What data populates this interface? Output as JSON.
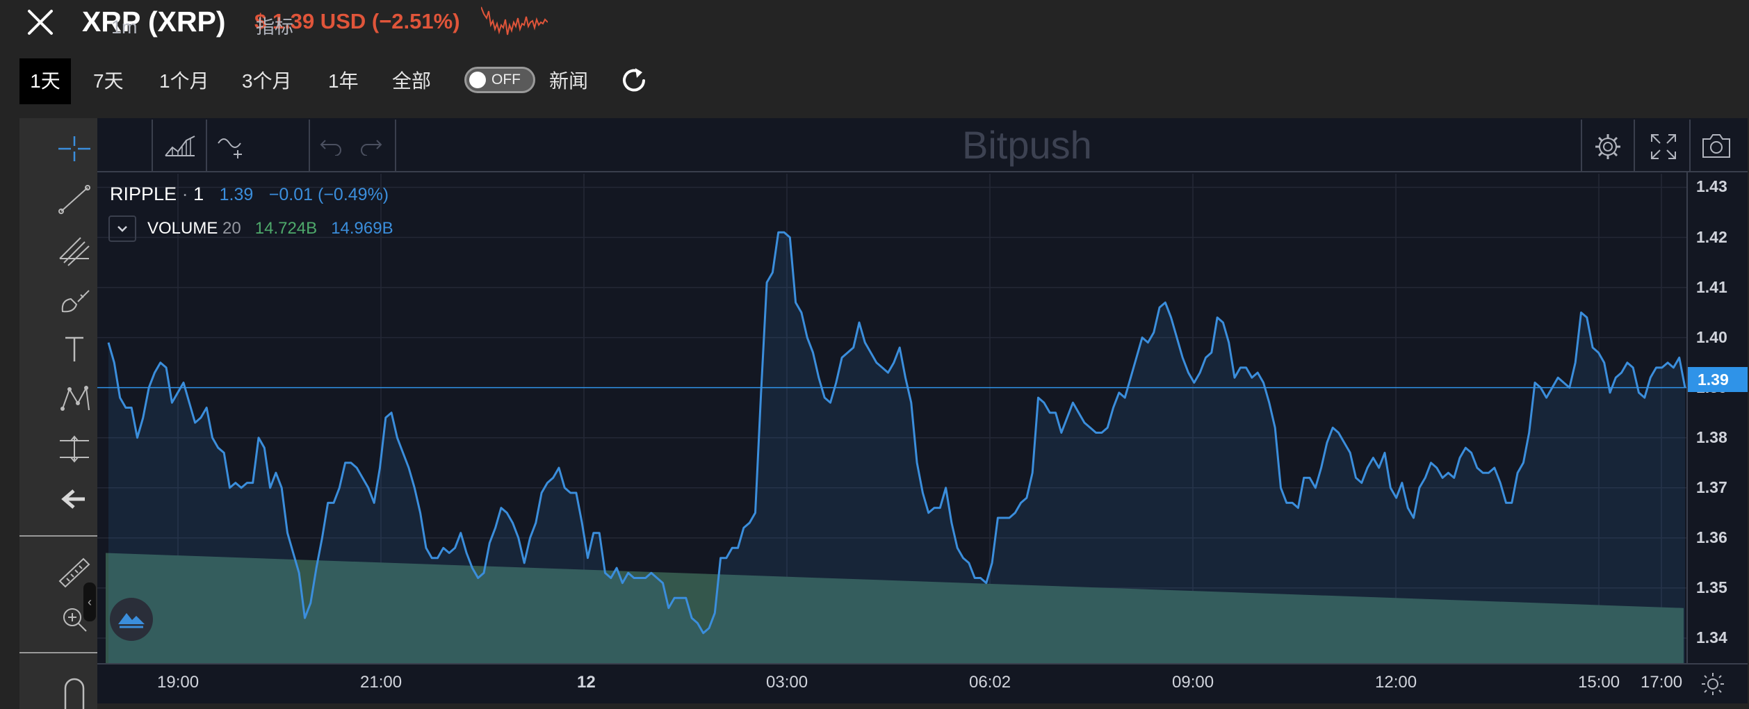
{
  "header": {
    "title": "XRP (XRP)",
    "price": "$ 1.39 USD (−2.51%)"
  },
  "ranges": [
    "1天",
    "7天",
    "1个月",
    "3个月",
    "1年",
    "全部"
  ],
  "toggle": {
    "state": "OFF",
    "label": "新闻"
  },
  "toolbar": {
    "interval": "1m",
    "indicators": "指标",
    "brand": "Bitpush"
  },
  "legend": {
    "symbol": "RIPPLE",
    "interval": "1",
    "last": "1.39",
    "change": "−0.01 (−0.49%)",
    "volume_label": "VOLUME",
    "volume_len": "20",
    "volume_a": "14.724B",
    "volume_b": "14.969B"
  },
  "colors": {
    "accent_negative": "#e0553a",
    "line": "#3b8edc",
    "volume": "#34574c",
    "background": "#131722"
  },
  "chart_data": {
    "type": "line",
    "series": [
      {
        "name": "RIPPLE",
        "values": [
          1.399,
          1.395,
          1.388,
          1.386,
          1.386,
          1.38,
          1.384,
          1.39,
          1.393,
          1.395,
          1.394,
          1.387,
          1.389,
          1.391,
          1.387,
          1.383,
          1.384,
          1.386,
          1.38,
          1.378,
          1.377,
          1.37,
          1.371,
          1.37,
          1.371,
          1.371,
          1.38,
          1.378,
          1.37,
          1.373,
          1.37,
          1.361,
          1.357,
          1.353,
          1.344,
          1.347,
          1.354,
          1.36,
          1.367,
          1.367,
          1.37,
          1.375,
          1.375,
          1.374,
          1.372,
          1.37,
          1.367,
          1.374,
          1.384,
          1.385,
          1.38,
          1.377,
          1.374,
          1.37,
          1.365,
          1.358,
          1.356,
          1.356,
          1.358,
          1.357,
          1.358,
          1.361,
          1.357,
          1.354,
          1.352,
          1.353,
          1.359,
          1.362,
          1.366,
          1.365,
          1.363,
          1.36,
          1.355,
          1.36,
          1.363,
          1.369,
          1.371,
          1.372,
          1.374,
          1.37,
          1.369,
          1.369,
          1.363,
          1.356,
          1.361,
          1.361,
          1.353,
          1.352,
          1.354,
          1.351,
          1.353,
          1.352,
          1.352,
          1.352,
          1.353,
          1.352,
          1.351,
          1.346,
          1.348,
          1.348,
          1.348,
          1.344,
          1.343,
          1.341,
          1.342,
          1.345,
          1.356,
          1.356,
          1.358,
          1.358,
          1.362,
          1.363,
          1.365,
          1.389,
          1.411,
          1.413,
          1.421,
          1.421,
          1.42,
          1.407,
          1.405,
          1.4,
          1.397,
          1.392,
          1.388,
          1.387,
          1.391,
          1.396,
          1.397,
          1.398,
          1.403,
          1.399,
          1.397,
          1.395,
          1.394,
          1.393,
          1.395,
          1.398,
          1.392,
          1.387,
          1.375,
          1.369,
          1.365,
          1.366,
          1.366,
          1.37,
          1.363,
          1.358,
          1.356,
          1.355,
          1.352,
          1.352,
          1.351,
          1.355,
          1.364,
          1.364,
          1.364,
          1.365,
          1.367,
          1.368,
          1.373,
          1.388,
          1.387,
          1.385,
          1.385,
          1.381,
          1.384,
          1.387,
          1.385,
          1.383,
          1.382,
          1.381,
          1.381,
          1.382,
          1.386,
          1.389,
          1.388,
          1.392,
          1.396,
          1.4,
          1.399,
          1.401,
          1.406,
          1.407,
          1.404,
          1.4,
          1.396,
          1.393,
          1.391,
          1.393,
          1.396,
          1.397,
          1.404,
          1.403,
          1.399,
          1.392,
          1.394,
          1.394,
          1.392,
          1.393,
          1.391,
          1.387,
          1.382,
          1.37,
          1.367,
          1.367,
          1.366,
          1.372,
          1.372,
          1.37,
          1.374,
          1.379,
          1.382,
          1.381,
          1.379,
          1.377,
          1.372,
          1.371,
          1.374,
          1.376,
          1.374,
          1.377,
          1.37,
          1.368,
          1.371,
          1.366,
          1.364,
          1.37,
          1.372,
          1.375,
          1.374,
          1.372,
          1.373,
          1.372,
          1.376,
          1.378,
          1.377,
          1.374,
          1.373,
          1.373,
          1.374,
          1.371,
          1.367,
          1.367,
          1.373,
          1.375,
          1.381,
          1.391,
          1.39,
          1.388,
          1.39,
          1.392,
          1.391,
          1.39,
          1.395,
          1.405,
          1.404,
          1.398,
          1.397,
          1.395,
          1.389,
          1.392,
          1.393,
          1.395,
          1.394,
          1.389,
          1.388,
          1.392,
          1.394,
          1.394,
          1.395,
          1.394,
          1.396,
          1.39
        ]
      }
    ],
    "volume": {
      "name": "VOLUME",
      "start_level": 1.357,
      "end_level": 1.346
    },
    "x_ticks": [
      "19:00",
      "21:00",
      "12",
      "03:00",
      "06:02",
      "09:00",
      "12:00",
      "15:00",
      "17:00"
    ],
    "y_ticks": [
      "1.43",
      "1.42",
      "1.41",
      "1.40",
      "1.39",
      "1.38",
      "1.37",
      "1.36",
      "1.35",
      "1.34"
    ],
    "ylim": [
      1.335,
      1.4327
    ],
    "last_value": "1.39",
    "grid": true
  }
}
